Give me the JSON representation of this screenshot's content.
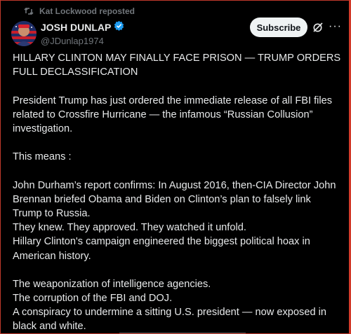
{
  "repost": {
    "text": "Kat Lockwood reposted",
    "icon": "repost-icon"
  },
  "author": {
    "display_name": "JOSH DUNLAP",
    "handle": "@JDunlap1974",
    "verified_color": "#1d9bf0"
  },
  "actions": {
    "subscribe_label": "Subscribe",
    "grok_icon": "grok-icon",
    "more_icon": "more-icon",
    "more_label": "···"
  },
  "post": {
    "headline": "HILLARY CLINTON MAY FINALLY FACE PRISON — TRUMP ORDERS FULL DECLASSIFICATION",
    "p1": "President Trump has just ordered the immediate release of all FBI files related to Crossfire Hurricane — the infamous “Russian Collusion” investigation.",
    "p2": "This means :",
    "p3_line1": "John Durham’s report confirms: In August 2016, then-CIA Director John Brennan briefed Obama and Biden on Clinton’s plan to falsely link Trump to Russia.",
    "p3_line2": "They knew. They approved. They watched it unfold.",
    "p3_line3": " Hillary Clinton's campaign engineered the biggest political hoax in American history.",
    "p4_line1": "The weaponization of intelligence agencies.",
    "p4_line2": "The corruption of the FBI and DOJ.",
    "p4_line3": "A conspiracy to undermine a sitting U.S. president — now exposed in black and white."
  },
  "colors": {
    "background": "#000000",
    "text": "#e7e9ea",
    "muted": "#71767b",
    "accent": "#1d9bf0"
  }
}
